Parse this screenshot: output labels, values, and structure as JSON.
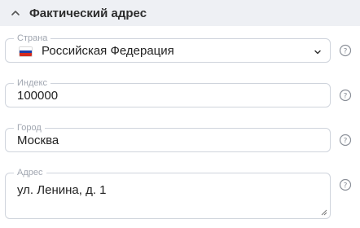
{
  "section": {
    "title": "Фактический адрес",
    "expanded": true,
    "icon": "chevron-up-icon"
  },
  "fields": {
    "country": {
      "label": "Страна",
      "value": "Российская Федерация",
      "flag": [
        "#ffffff",
        "#1c3fa8",
        "#d52b1e"
      ]
    },
    "index": {
      "label": "Индекс",
      "value": "100000"
    },
    "city": {
      "label": "Город",
      "value": "Москва"
    },
    "address": {
      "label": "Адрес",
      "value": "ул. Ленина, д. 1"
    }
  },
  "help_icon": "help-circle-icon"
}
